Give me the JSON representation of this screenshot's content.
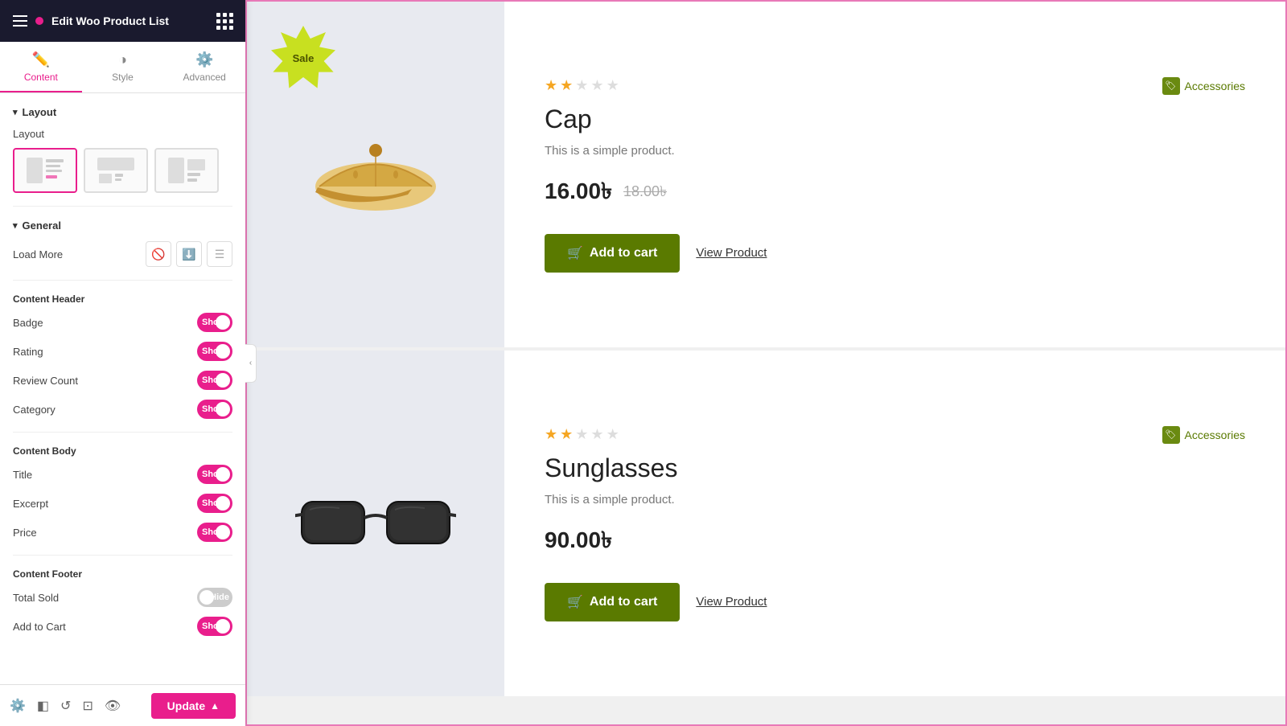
{
  "header": {
    "title": "Edit Woo Product List",
    "dot_color": "#e91e8c"
  },
  "tabs": [
    {
      "id": "content",
      "label": "Content",
      "icon": "✏️",
      "active": true
    },
    {
      "id": "style",
      "label": "Style",
      "icon": "◑",
      "active": false
    },
    {
      "id": "advanced",
      "label": "Advanced",
      "icon": "⚙️",
      "active": false
    }
  ],
  "sections": {
    "layout": {
      "title": "Layout",
      "layout_label": "Layout",
      "options": [
        "layout-1",
        "layout-2",
        "layout-3"
      ],
      "selected": 0
    },
    "general": {
      "title": "General",
      "load_more_label": "Load More"
    },
    "content_header": {
      "title": "Content Header",
      "fields": [
        {
          "label": "Badge",
          "toggle": "Show",
          "state": "show"
        },
        {
          "label": "Rating",
          "toggle": "Show",
          "state": "show"
        },
        {
          "label": "Review Count",
          "toggle": "Show",
          "state": "show"
        },
        {
          "label": "Category",
          "toggle": "Show",
          "state": "show"
        }
      ]
    },
    "content_body": {
      "title": "Content Body",
      "fields": [
        {
          "label": "Title",
          "toggle": "Show",
          "state": "show"
        },
        {
          "label": "Excerpt",
          "toggle": "Show",
          "state": "show"
        },
        {
          "label": "Price",
          "toggle": "Show",
          "state": "show"
        }
      ]
    },
    "content_footer": {
      "title": "Content Footer",
      "fields": [
        {
          "label": "Total Sold",
          "toggle": "Hide",
          "state": "hide"
        },
        {
          "label": "Add to Cart",
          "toggle": "Show",
          "state": "show"
        }
      ]
    }
  },
  "footer": {
    "update_label": "Update"
  },
  "products": [
    {
      "id": "cap",
      "badge": "Sale",
      "name": "Cap",
      "excerpt": "This is a simple product.",
      "price_current": "16.00৳",
      "price_original": "18.00৳",
      "rating": 2.5,
      "category": "Accessories",
      "add_to_cart": "Add to cart",
      "view_product": "View Product",
      "has_sale_badge": true
    },
    {
      "id": "sunglasses",
      "badge": "",
      "name": "Sunglasses",
      "excerpt": "This is a simple product.",
      "price_current": "90.00৳",
      "price_original": "",
      "rating": 2.5,
      "category": "Accessories",
      "add_to_cart": "Add to cart",
      "view_product": "View Product",
      "has_sale_badge": false
    }
  ]
}
